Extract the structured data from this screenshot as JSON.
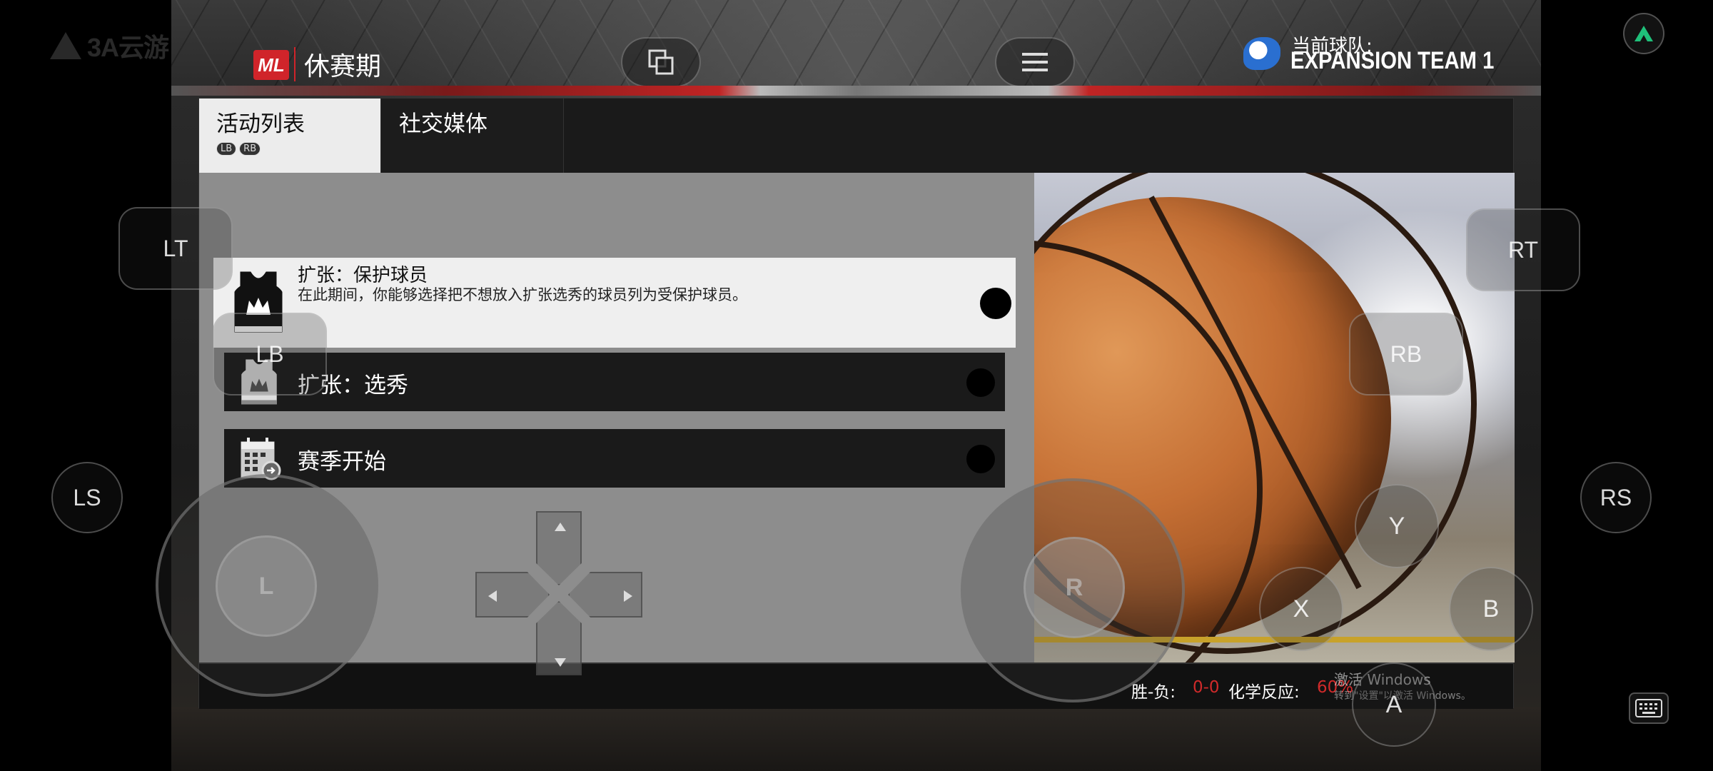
{
  "watermark": "3A云游",
  "header": {
    "logo_text": "ML",
    "title": "休赛期",
    "team_label": "当前球队:",
    "team_name": "EXPANSION TEAM 1"
  },
  "tabs": [
    {
      "label": "活动列表",
      "hint": [
        "LB",
        "RB"
      ],
      "active": true
    },
    {
      "label": "社交媒体",
      "active": false
    }
  ],
  "events": [
    {
      "title": "扩张：保护球员",
      "description": "在此期间，你能够选择把不想放入扩张选秀的球员列为受保护球员。",
      "icon": "jersey-crown-icon",
      "selected": true
    },
    {
      "title": "扩张：选秀",
      "icon": "jersey-crown-icon",
      "selected": false
    },
    {
      "title": "赛季开始",
      "icon": "calendar-icon",
      "selected": false
    }
  ],
  "footer": {
    "record_label": "胜-负:",
    "record_value": "0-0",
    "chemistry_label": "化学反应:",
    "chemistry_value": "60%",
    "windows_activate": "激活 Windows",
    "windows_activate_sub": "转到\"设置\"以激活 Windows。"
  },
  "controls": {
    "lt": "LT",
    "rt": "RT",
    "lb": "LB",
    "rb": "RB",
    "ls": "LS",
    "rs": "RS",
    "left_stick": "L",
    "right_stick": "R",
    "y": "Y",
    "x": "X",
    "b": "B",
    "a": "A"
  },
  "colors": {
    "accent_red": "#d0242a",
    "stat_red": "#d02a2a",
    "selected_row": "#efefef",
    "unselected_row": "#1a1a1a"
  }
}
